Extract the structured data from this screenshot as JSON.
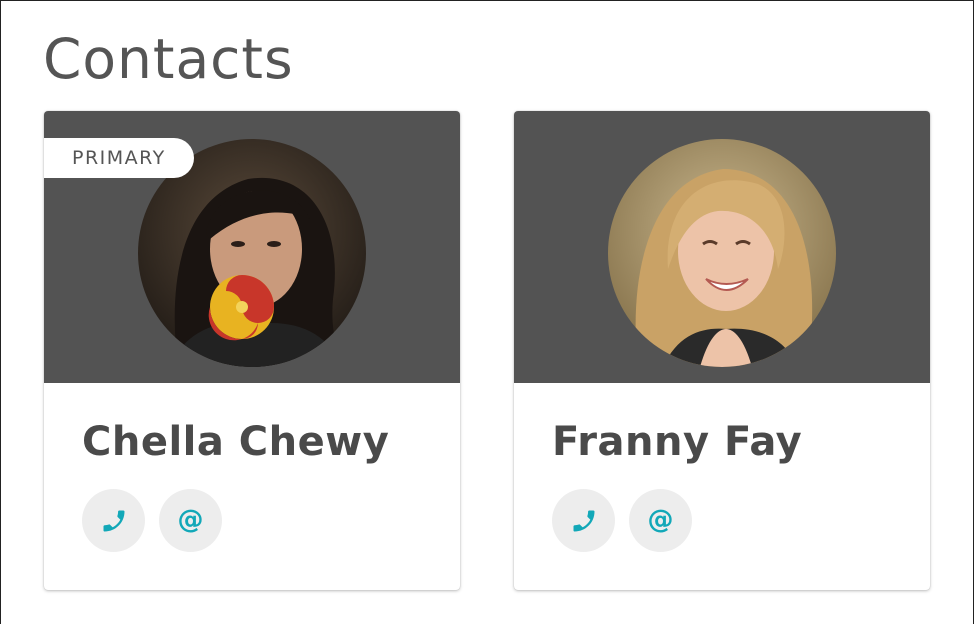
{
  "page": {
    "title": "Contacts"
  },
  "colors": {
    "accent": "#12a8b8",
    "card_header": "#535353",
    "action_bg": "#ededed",
    "text": "#4a4a4a"
  },
  "contacts": [
    {
      "name": "Chella Chewy",
      "badge": "PRIMARY",
      "avatar_icon": "avatar-woman-dark-hair-lollipop",
      "actions": [
        {
          "icon": "phone-icon"
        },
        {
          "icon": "email-at-icon",
          "glyph": "@"
        }
      ]
    },
    {
      "name": "Franny Fay",
      "avatar_icon": "avatar-woman-blonde-smiling",
      "actions": [
        {
          "icon": "phone-icon"
        },
        {
          "icon": "email-at-icon",
          "glyph": "@"
        }
      ]
    }
  ]
}
